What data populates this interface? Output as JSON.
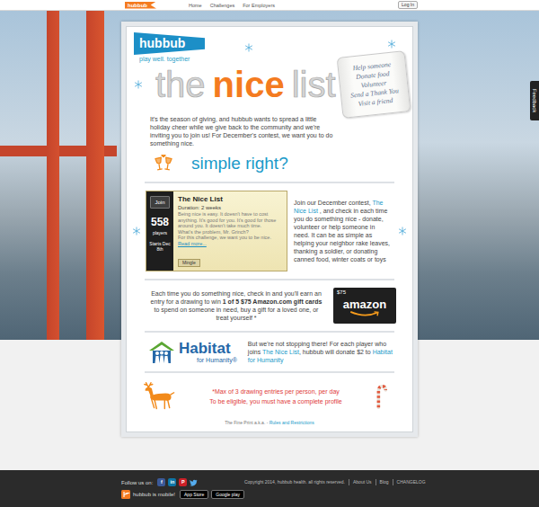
{
  "nav": {
    "logo": "hubbub",
    "links": [
      {
        "label": "Home"
      },
      {
        "label": "Challenges"
      },
      {
        "label": "For Employers"
      }
    ],
    "login": "Log In"
  },
  "feedback": "Feedback",
  "brand": {
    "name": "hubbub",
    "tagline": "play well. together"
  },
  "title": [
    {
      "text": "the",
      "kind": "plain"
    },
    {
      "text": "nice",
      "kind": "accent"
    },
    {
      "text": "list",
      "kind": "plain"
    }
  ],
  "scroll": [
    "Help someone",
    "Donate food",
    "Volunteer",
    "Send a Thank You",
    "Visit a friend"
  ],
  "intro": "It's the season of giving, and hubbub wants to spread a little holiday cheer while we give back to the community and we're inviting you to join us! For December's contest, we want you to do something nice.",
  "subheading": "simple right?",
  "challenge": {
    "join": "Join",
    "players": "558",
    "players_label": "players",
    "starts": "Starts Dec 8th",
    "title": "The Nice List",
    "duration": "Duration: 2 weeks",
    "description": [
      "Being nice is easy. It doesn't have to cost anything. It's good for you. It's good for those around you. It doesn't take much time.",
      "What's the problem, Mr. Grinch?",
      "For this challenge, we want you to be nice. "
    ],
    "read_more": "Read more...",
    "tag": "Mingle"
  },
  "contest": [
    {
      "text": "Join our December contest, ",
      "kind": "plain"
    },
    {
      "text": "The Nice List",
      "kind": "link"
    },
    {
      "text": " , and check in each time you do something nice - donate, volunteer or help someone in need. It can be as simple as helping your neighbor rake leaves, thanking a soldier, or donating canned food, winter coats or toys",
      "kind": "plain"
    }
  ],
  "drawing": [
    {
      "text": "Each time you do something nice, check in and you'll earn an entry for a drawing to win ",
      "kind": "plain"
    },
    {
      "text": "1 of 5 $75 Amazon.com gift cards",
      "kind": "bold"
    },
    {
      "text": " to spend on someone in need, buy a gift for a loved one, or treat yourself *",
      "kind": "plain"
    }
  ],
  "gift_card": {
    "amount": "$75",
    "brand": "amazon"
  },
  "habitat": {
    "name": "Habitat",
    "sub": "for Humanity®",
    "text": [
      {
        "text": "But we're not stopping there! For each player who joins ",
        "kind": "plain"
      },
      {
        "text": "The Nice List",
        "kind": "link"
      },
      {
        "text": ", hubbub will donate $2 to ",
        "kind": "plain"
      },
      {
        "text": "Habitat for Humanity",
        "kind": "link"
      }
    ]
  },
  "rules": [
    "*Max of 3 drawing entries per person, per day",
    "To be eligible, you must have a complete profile"
  ],
  "fine_print": [
    {
      "text": "The Fine Print a.k.a. - ",
      "kind": "plain"
    },
    {
      "text": "Rules and Restrictions",
      "kind": "link"
    }
  ],
  "footer": {
    "follow": "Follow us on:",
    "social": [
      {
        "kind": "letter",
        "glyph": "f",
        "color": "#3b5998"
      },
      {
        "kind": "letter",
        "glyph": "in",
        "color": "#0e76a8"
      },
      {
        "kind": "letter",
        "glyph": "P",
        "color": "#cb2027"
      },
      {
        "kind": "bird",
        "glyph": "",
        "color": "#55acee"
      }
    ],
    "mobile": "hubbub is mobile!",
    "stores": [
      "App Store",
      "Google play"
    ],
    "copyright": "Copyright 2014, hubbub health. all rights reserved.",
    "links": [
      "About Us",
      "Blog",
      "CHANGELOG"
    ]
  }
}
